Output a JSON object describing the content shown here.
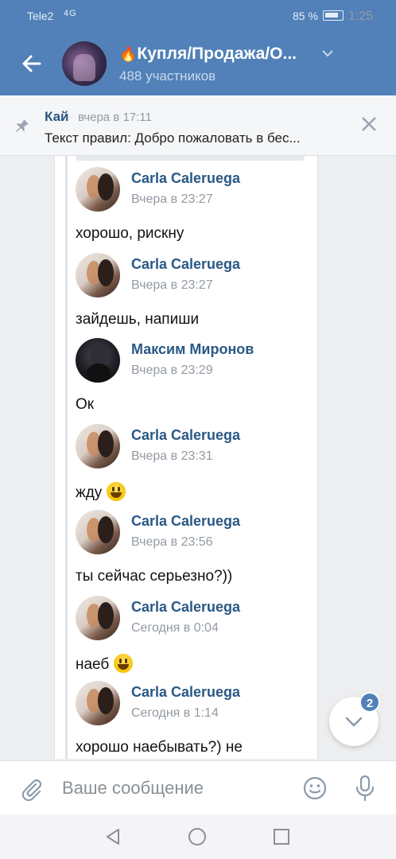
{
  "status_bar": {
    "carrier": "Tele2",
    "signal": "4G",
    "battery": "85 %",
    "time": "1:25"
  },
  "header": {
    "title": "Купля/Продажа/О...",
    "title_prefix_icon": "fire-emoji",
    "members": "488 участников"
  },
  "pinned": {
    "author": "Кай",
    "time": "вчера в 17:11",
    "text": "Текст правил: Добро пожаловать в бес..."
  },
  "messages": [
    {
      "author": "Carla Caleruega",
      "time": "Вчера в 23:27",
      "text": "хорошо, рискну",
      "avatar": "couple"
    },
    {
      "author": "Carla Caleruega",
      "time": "Вчера в 23:27",
      "text": "зайдешь, напиши",
      "avatar": "couple"
    },
    {
      "author": "Максим Миронов",
      "time": "Вчера в 23:29",
      "text": "Ок",
      "avatar": "dark"
    },
    {
      "author": "Carla Caleruega",
      "time": "Вчера в 23:31",
      "text": "жду",
      "emoji": "grinning-face",
      "avatar": "couple"
    },
    {
      "author": "Carla Caleruega",
      "time": "Вчера в 23:56",
      "text": "ты сейчас серьезно?))",
      "avatar": "couple"
    },
    {
      "author": "Carla Caleruega",
      "time": "Сегодня в 0:04",
      "text": "наеб",
      "emoji": "grinning-face",
      "avatar": "couple"
    },
    {
      "author": "Carla Caleruega",
      "time": "Сегодня в 1:14",
      "text": "хорошо наебывать?) не",
      "avatar": "couple"
    }
  ],
  "scroll_badge": "2",
  "composer": {
    "placeholder": "Ваше сообщение"
  },
  "colors": {
    "vk_blue": "#5181b8",
    "link_blue": "#2a5885"
  }
}
